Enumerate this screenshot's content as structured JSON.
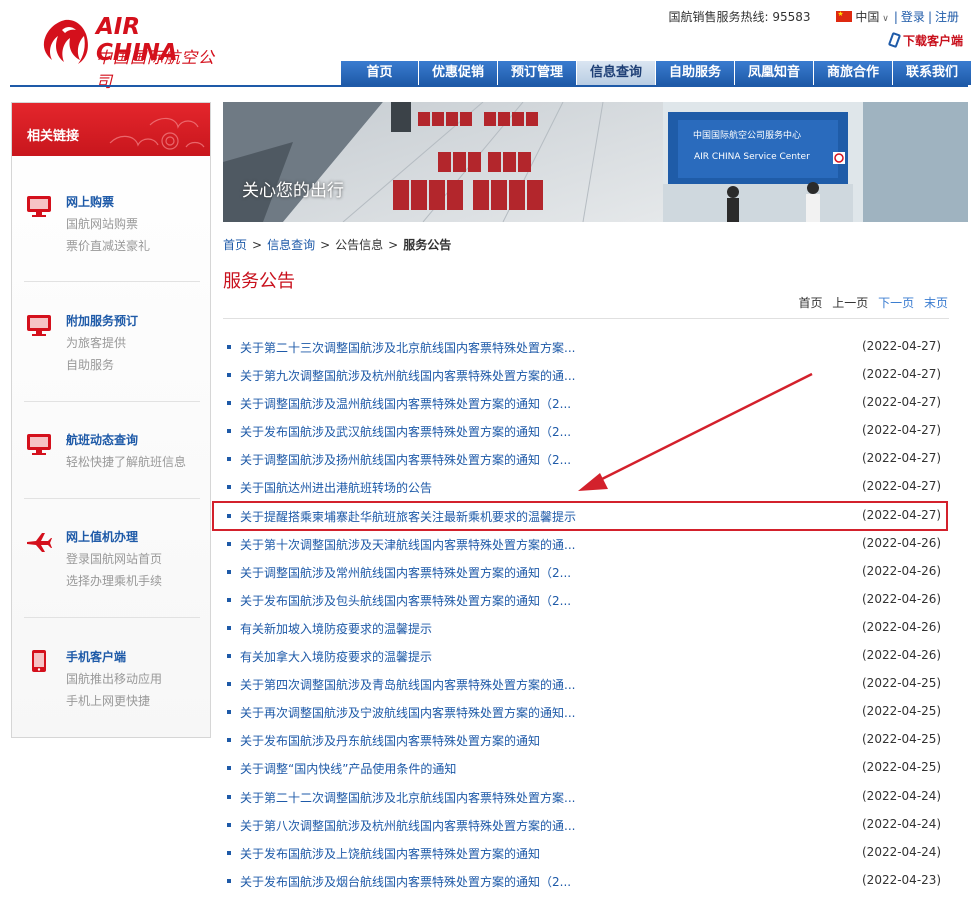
{
  "header": {
    "logo_en": "AIR CHINA",
    "logo_cn": "中国国际航空公司",
    "hotline": "国航销售服务热线: 95583",
    "region": "中国",
    "login": "登录",
    "register": "注册",
    "download": "下载客户端",
    "nav": [
      "首页",
      "优惠促销",
      "预订管理",
      "信息查询",
      "自助服务",
      "凤凰知音",
      "商旅合作",
      "联系我们"
    ],
    "nav_active_index": 3,
    "brand_color": "#d4101c",
    "nav_color": "#1e5aa8"
  },
  "sidebar": {
    "title": "相关链接",
    "items": [
      {
        "name": "网上购票",
        "desc1": "国航网站购票",
        "desc2": "票价直减送豪礼",
        "icon": "monitor-icon"
      },
      {
        "name": "附加服务预订",
        "desc1": "为旅客提供",
        "desc2": "自助服务",
        "icon": "monitor-icon"
      },
      {
        "name": "航班动态查询",
        "desc1": "轻松快捷了解航班信息",
        "desc2": "",
        "icon": "monitor-icon"
      },
      {
        "name": "网上值机办理",
        "desc1": "登录国航网站首页",
        "desc2": "选择办理乘机手续",
        "icon": "airplane-icon"
      },
      {
        "name": "手机客户端",
        "desc1": "国航推出移动应用",
        "desc2": "手机上网更快捷",
        "icon": "mobile-phone-icon"
      }
    ]
  },
  "banner": {
    "caption": "关心您的出行",
    "sign_cn": "中国国际航空公司服务中心",
    "sign_en": "AIR CHINA Service Center"
  },
  "breadcrumb": {
    "items": [
      "首页",
      "信息查询",
      "公告信息"
    ],
    "current": "服务公告"
  },
  "page_title": "服务公告",
  "pager": {
    "first": "首页",
    "prev": "上一页",
    "next": "下一页",
    "last": "末页"
  },
  "announcements": [
    {
      "title": "关于第二十三次调整国航涉及北京航线国内客票特殊处置方案...",
      "date": "(2022-04-27)"
    },
    {
      "title": "关于第九次调整国航涉及杭州航线国内客票特殊处置方案的通...",
      "date": "(2022-04-27)"
    },
    {
      "title": "关于调整国航涉及温州航线国内客票特殊处置方案的通知（2...",
      "date": "(2022-04-27)"
    },
    {
      "title": "关于发布国航涉及武汉航线国内客票特殊处置方案的通知（2...",
      "date": "(2022-04-27)"
    },
    {
      "title": "关于调整国航涉及扬州航线国内客票特殊处置方案的通知（2...",
      "date": "(2022-04-27)"
    },
    {
      "title": "关于国航达州进出港航班转场的公告",
      "date": "(2022-04-27)"
    },
    {
      "title": "关于提醒搭乘柬埔寨赴华航班旅客关注最新乘机要求的温馨提示",
      "date": "(2022-04-27)"
    },
    {
      "title": "关于第十次调整国航涉及天津航线国内客票特殊处置方案的通...",
      "date": "(2022-04-26)"
    },
    {
      "title": "关于调整国航涉及常州航线国内客票特殊处置方案的通知（2...",
      "date": "(2022-04-26)"
    },
    {
      "title": "关于发布国航涉及包头航线国内客票特殊处置方案的通知（2...",
      "date": "(2022-04-26)"
    },
    {
      "title": "有关新加坡入境防疫要求的温馨提示",
      "date": "(2022-04-26)"
    },
    {
      "title": "有关加拿大入境防疫要求的温馨提示",
      "date": "(2022-04-26)"
    },
    {
      "title": "关于第四次调整国航涉及青岛航线国内客票特殊处置方案的通...",
      "date": "(2022-04-25)"
    },
    {
      "title": "关于再次调整国航涉及宁波航线国内客票特殊处置方案的通知...",
      "date": "(2022-04-25)"
    },
    {
      "title": "关于发布国航涉及丹东航线国内客票特殊处置方案的通知",
      "date": "(2022-04-25)"
    },
    {
      "title": "关于调整“国内快线”产品使用条件的通知",
      "date": "(2022-04-25)"
    },
    {
      "title": "关于第二十二次调整国航涉及北京航线国内客票特殊处置方案...",
      "date": "(2022-04-24)"
    },
    {
      "title": "关于第八次调整国航涉及杭州航线国内客票特殊处置方案的通...",
      "date": "(2022-04-24)"
    },
    {
      "title": "关于发布国航涉及上饶航线国内客票特殊处置方案的通知",
      "date": "(2022-04-24)"
    },
    {
      "title": "关于发布国航涉及烟台航线国内客票特殊处置方案的通知（2...",
      "date": "(2022-04-23)"
    }
  ],
  "highlighted_index": 6,
  "highlight_color": "#d3212c"
}
